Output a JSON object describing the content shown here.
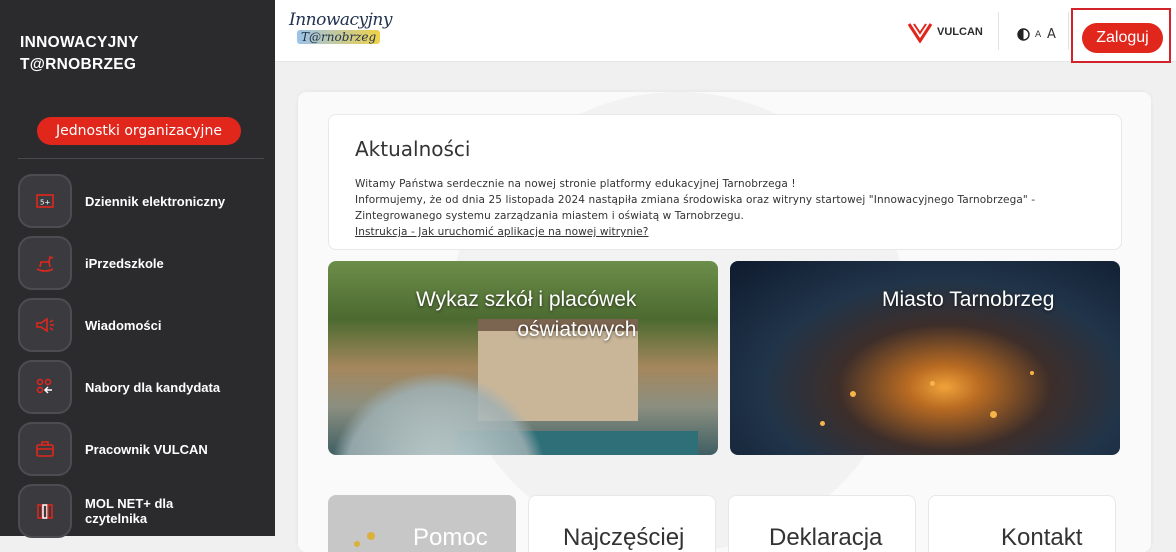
{
  "sidebar": {
    "brand_line1": "INNOWACYJNY",
    "brand_line2": "T@RNOBRZEG",
    "units_button": "Jednostki organizacyjne",
    "items": [
      {
        "label": "Dziennik elektroniczny",
        "icon": "gradebook-icon"
      },
      {
        "label": "iPrzedszkole",
        "icon": "rocking-horse-icon"
      },
      {
        "label": "Wiadomości",
        "icon": "megaphone-icon"
      },
      {
        "label": "Nabory dla kandydata",
        "icon": "recruitment-icon"
      },
      {
        "label": "Pracownik VULCAN",
        "icon": "briefcase-icon"
      },
      {
        "label": "MOL NET+ dla czytelnika",
        "icon": "books-icon"
      }
    ]
  },
  "header": {
    "logo_line1": "Innowacyjny",
    "logo_line2": "T@rnobrzeg",
    "vulcan_label": "VULCAN",
    "font_small": "A",
    "font_large": "A",
    "login_button": "Zaloguj"
  },
  "news": {
    "title": "Aktualności",
    "line1": "Witamy Państwa serdecznie na nowej stronie platformy edukacyjnej Tarnobrzega !",
    "line2": "Informujemy, że od dnia 25 listopada 2024 nastąpiła zmiana środowiska oraz witryny startowej \"Innowacyjnego Tarnobrzega\" -",
    "line3": "Zintegrowanego systemu zarządzania miastem i oświatą w Tarnobrzegu.",
    "link": "Instrukcja - Jak uruchomić aplikacje na nowej witrynie?"
  },
  "tiles": [
    {
      "title_line1": "Wykaz szkół i placówek",
      "title_line2": "oświatowych"
    },
    {
      "title": "Miasto Tarnobrzeg"
    }
  ],
  "cards": [
    "Pomoc",
    "Najczęściej",
    "Deklaracja",
    "Kontakt"
  ],
  "colors": {
    "accent": "#e1261c",
    "sidebar": "#2b2b2e"
  }
}
